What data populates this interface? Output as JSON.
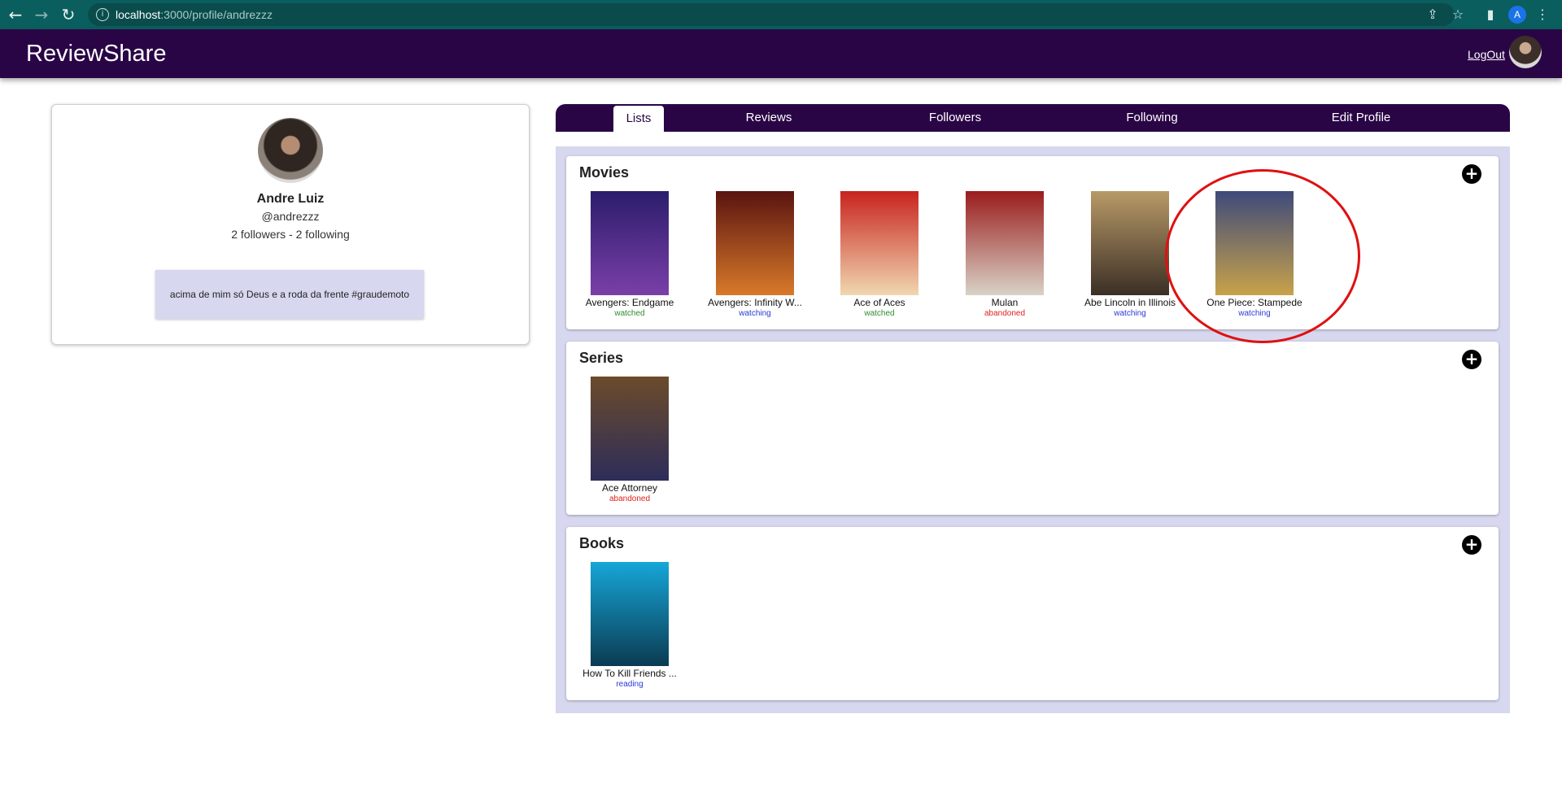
{
  "browser": {
    "url_host": "localhost",
    "url_path": ":3000/profile/andrezzz",
    "profile_initial": "A"
  },
  "app": {
    "brand": "ReviewShare",
    "logout": "LogOut"
  },
  "profile": {
    "name": "Andre Luiz",
    "handle": "@andrezzz",
    "follow_stats": "2 followers - 2 following",
    "bio": "acima de mim só Deus e a roda da frente #graudemoto"
  },
  "tabs": [
    {
      "label": "Lists",
      "active": true
    },
    {
      "label": "Reviews"
    },
    {
      "label": "Followers"
    },
    {
      "label": "Following"
    },
    {
      "label": "Edit Profile"
    }
  ],
  "sections": [
    {
      "title": "Movies",
      "items": [
        {
          "title": "Avengers: Endgame",
          "status": "watched",
          "colors": [
            "#2b1d6b",
            "#7a3fa8"
          ]
        },
        {
          "title": "Avengers: Infinity W...",
          "status": "watching",
          "colors": [
            "#5a1410",
            "#d8792a"
          ]
        },
        {
          "title": "Ace of Aces",
          "status": "watched",
          "colors": [
            "#c8231e",
            "#f0d7b0"
          ]
        },
        {
          "title": "Mulan",
          "status": "abandoned",
          "colors": [
            "#9a1c1c",
            "#d9d2c7"
          ]
        },
        {
          "title": "Abe Lincoln in Illinois",
          "status": "watching",
          "colors": [
            "#b89a68",
            "#3b2f25"
          ]
        },
        {
          "title": "One Piece: Stampede",
          "status": "watching",
          "colors": [
            "#3e4a7a",
            "#c8a24a"
          ]
        }
      ]
    },
    {
      "title": "Series",
      "items": [
        {
          "title": "Ace Attorney",
          "status": "abandoned",
          "colors": [
            "#6b4b2a",
            "#2d2d5a"
          ]
        }
      ]
    },
    {
      "title": "Books",
      "items": [
        {
          "title": "How To Kill Friends ...",
          "status": "reading",
          "colors": [
            "#16a6d8",
            "#0b3b52"
          ]
        }
      ]
    }
  ]
}
